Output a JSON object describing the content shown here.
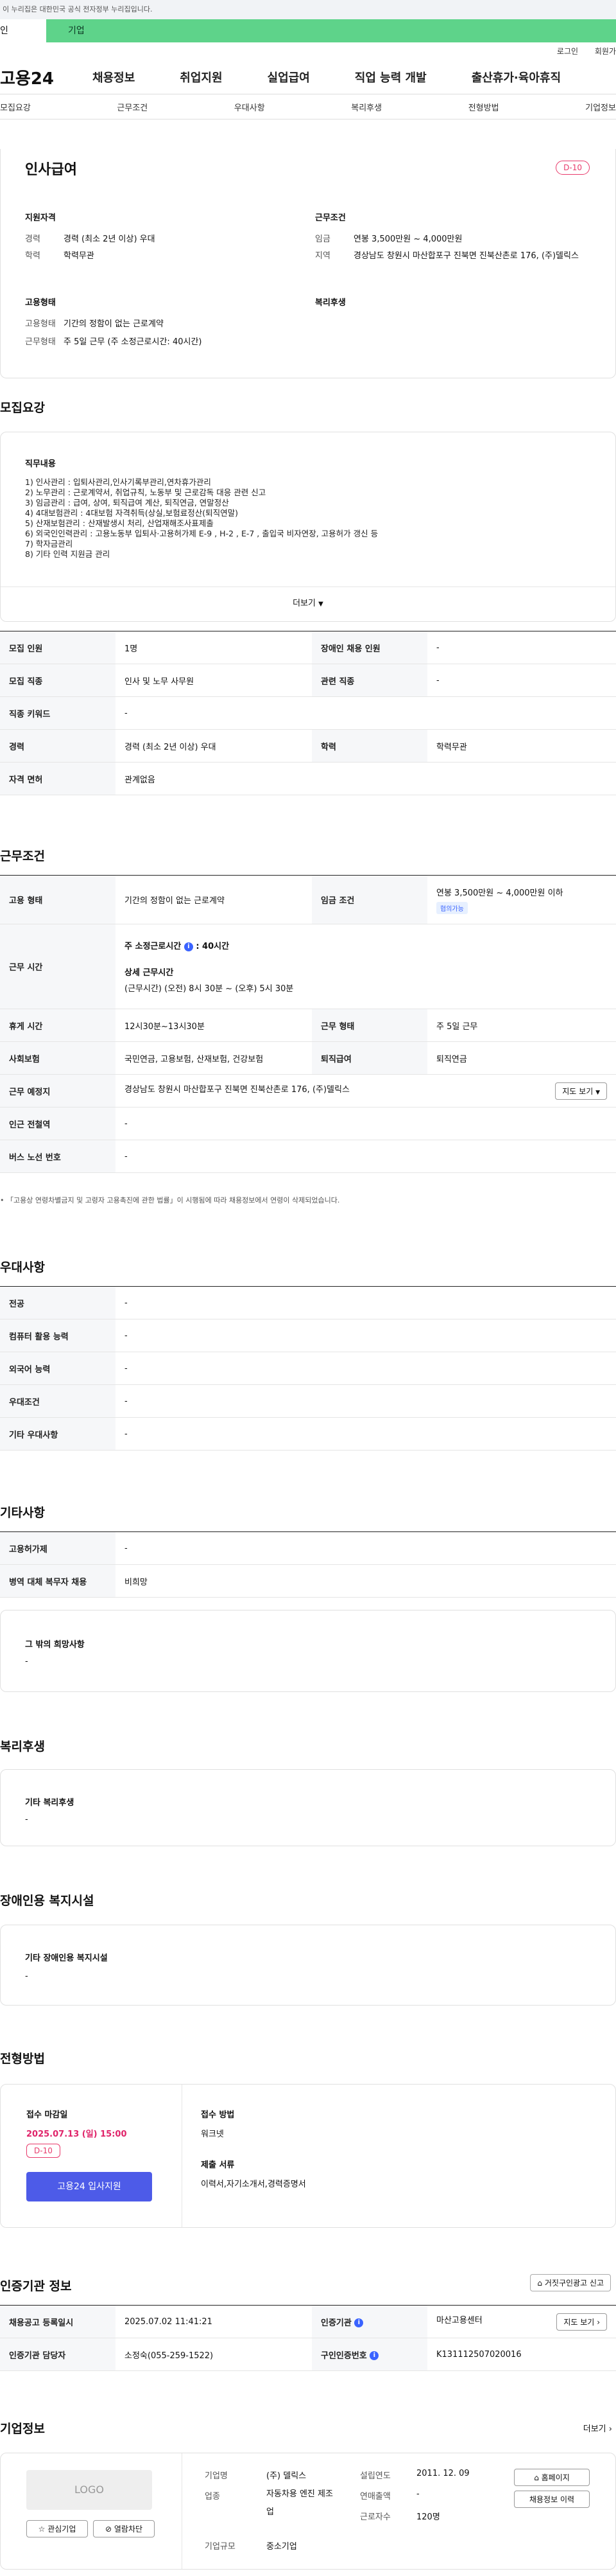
{
  "top": {
    "gov_notice": "이 누리집은 대한민국 공식 전자정부 누리집입니다.",
    "service_tabs": [
      "인",
      "기업"
    ],
    "util_links": [
      "로그인",
      "회원가"
    ],
    "logo": "고용24",
    "gnb": [
      "채용정보",
      "취업지원",
      "실업급여",
      "직업 능력 개발",
      "출산휴가·육아휴직"
    ],
    "anchor_tabs": [
      "모집요강",
      "근무조건",
      "우대사항",
      "복리후생",
      "전형방법",
      "기업정보"
    ]
  },
  "summary": {
    "title": "인사급여",
    "dday": "D-10",
    "qual_title": "지원자격",
    "career_k": "경력",
    "career_v": "경력 (최소 2년 이상) 우대",
    "edu_k": "학력",
    "edu_v": "학력무관",
    "work_title": "근무조건",
    "wage_k": "임금",
    "wage_v": "연봉 3,500만원 ~ 4,000만원",
    "region_k": "지역",
    "region_v": "경상남도 창원시 마산합포구 진북면 진북산촌로 176, (주)델릭스",
    "emp_title": "고용형태",
    "emptype_k": "고용형태",
    "emptype_v": "기간의 정함이 없는 근로계약",
    "worktype_k": "근무형태",
    "worktype_v": "주 5일 근무 (주 소정근로시간: 40시간)",
    "welfare_title": "복리후생"
  },
  "recruit": {
    "title": "모집요강",
    "job_title": "직무내용",
    "job_lines": [
      "1) 인사관리 : 입퇴사관리,인사기록부관리,연차휴가관리",
      "2) 노무관리 : 근로계약서, 취업규칙, 노동부 및 근로감독 대응 관련 신고",
      "3) 임금관리 : 급여, 상여, 퇴직급여 계산, 퇴직연금, 연말정산",
      "4) 4대보험관리 : 4대보험 자격취득(상실,보험료정산(퇴직연말)",
      "5) 산재보험관리 : 산재발생시 처리, 산업재해조사표제출",
      "6) 외국인인력관리 : 고용노동부 입퇴사·고용허가제 E-9 , H-2 , E-7 , 출입국 비자연장, 고용허가 갱신 등",
      "7) 학자금관리",
      "8) 기타 인력 지원금 관리"
    ],
    "more": "더보기",
    "rows": [
      {
        "k1": "모집 인원",
        "v1": "1명",
        "k2": "장애인 채용 인원",
        "v2": "-"
      },
      {
        "k1": "모집 직종",
        "v1": "인사 및 노무 사무원",
        "k2": "관련 직종",
        "v2": "-"
      },
      {
        "k1": "직종 키워드",
        "v1": "-"
      },
      {
        "k1": "경력",
        "v1": "경력 (최소 2년 이상) 우대",
        "k2": "학력",
        "v2": "학력무관"
      },
      {
        "k1": "자격 면허",
        "v1": "관계없음"
      }
    ]
  },
  "conditions": {
    "title": "근무조건",
    "emp_k": "고용 형태",
    "emp_v": "기간의 정함이 없는 근로계약",
    "wage_k": "임금 조건",
    "wage_v": "연봉 3,500만원 ~ 4,000만원 이하",
    "wage_tag": "협의가능",
    "hours_k": "근무 시간",
    "hours_total": "주 소정근로시간",
    "hours_total_v": ": 40시간",
    "hours_detail_t": "상세 근무시간",
    "hours_detail": "(근무시간) (오전) 8시 30분 ~ (오후) 5시 30분",
    "rest_k": "휴게 시간",
    "rest_v": "12시30분~13시30분",
    "form_k": "근무 형태",
    "form_v": "주 5일 근무",
    "ins_k": "사회보험",
    "ins_v": "국민연금, 고용보험, 산재보험, 건강보험",
    "ret_k": "퇴직급여",
    "ret_v": "퇴직연금",
    "place_k": "근무 예정지",
    "place_v": "경상남도 창원시 마산합포구 진북면 진북산촌로 176, (주)델릭스",
    "map_btn": "지도 보기",
    "station_k": "인근 전철역",
    "station_v": "-",
    "bus_k": "버스 노선 번호",
    "bus_v": "-",
    "note": "「고용상 연령차별금지 및 고령자 고용촉진에 관한 법률」이 시행됨에 따라 채용정보에서 연령이 삭제되었습니다."
  },
  "preference": {
    "title": "우대사항",
    "rows": [
      [
        "전공",
        "-"
      ],
      [
        "컴퓨터 활용 능력",
        "-"
      ],
      [
        "외국어 능력",
        "-"
      ],
      [
        "우대조건",
        "-"
      ],
      [
        "기타 우대사항",
        "-"
      ]
    ]
  },
  "others": {
    "title": "기타사항",
    "rows": [
      [
        "고용허가제",
        "-"
      ],
      [
        "병역 대체 복무자 채용",
        "비희망"
      ]
    ],
    "wish_title": "그 밖의 희망사항",
    "wish_v": "-"
  },
  "welfare": {
    "title": "복리후생",
    "box_title": "기타 복리후생",
    "box_v": "-"
  },
  "disabled": {
    "title": "장애인용 복지시설",
    "box_title": "기타 장애인용 복지시설",
    "box_v": "-"
  },
  "process": {
    "title": "전형방법",
    "deadline_t": "접수 마감일",
    "deadline_v": "2025.07.13 (일) 15:00",
    "dday": "D-10",
    "apply_btn": "고용24 입사지원",
    "method_t": "접수 방법",
    "method_v": "워크넷",
    "docs_t": "제출 서류",
    "docs_v": "이력서,자기소개서,경력증명서"
  },
  "cert": {
    "title": "인증기관 정보",
    "report_btn": "거짓구인광고 신고",
    "reg_k": "채용공고 등록일시",
    "reg_v": "2025.07.02 11:41:21",
    "org_k": "인증기관",
    "org_v": "마산고용센터",
    "map_btn": "지도 보기",
    "mgr_k": "인증기관 담당자",
    "mgr_v": "소정숙(055-259-1522)",
    "num_k": "구인인증번호",
    "num_v": "K131112507020016"
  },
  "company": {
    "title": "기업정보",
    "more": "더보기",
    "logo": "LOGO",
    "interest_btn": "관심기업",
    "block_btn": "열람차단",
    "name_k": "기업명",
    "name_v": "(주) 델릭스",
    "industry_k": "업종",
    "industry_v": "자동차용 엔진 제조업",
    "size_k": "기업규모",
    "size_v": "중소기업",
    "year_k": "설립연도",
    "year_v": "2011. 12. 09",
    "sales_k": "연매출액",
    "sales_v": "-",
    "emp_k": "근로자수",
    "emp_v": "120명",
    "home_btn": "홈페이지",
    "jobs_btn": "채용정보 이력"
  }
}
